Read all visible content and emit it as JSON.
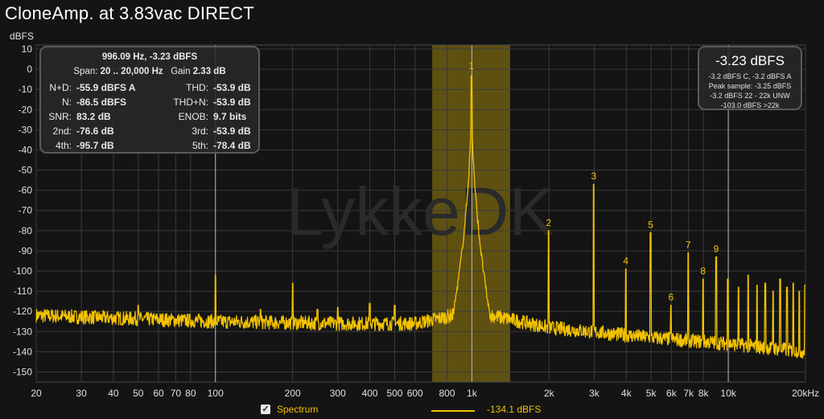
{
  "page": {
    "title": "CloneAmp. at 3.83vac DIRECT",
    "watermark": "LykkeDK",
    "colors": {
      "background": "#141414",
      "trace": "#f2c200",
      "band": "#6b5a10",
      "grid": "#3a3a3a"
    }
  },
  "measurements": {
    "header": "996.09 Hz, -3.23 dBFS",
    "span_label": "Span:",
    "span_value": "20 .. 20,000 Hz",
    "gain_label": "Gain",
    "gain_value": "2.33 dB",
    "rows": [
      {
        "l1": "N+D:",
        "v1": "-55.9 dBFS A",
        "l2": "THD:",
        "v2": "-53.9 dB"
      },
      {
        "l1": "N:",
        "v1": "-86.5 dBFS",
        "l2": "THD+N:",
        "v2": "-53.9 dB"
      },
      {
        "l1": "SNR:",
        "v1": "83.2 dB",
        "l2": "ENOB:",
        "v2": "9.7 bits"
      },
      {
        "l1": "2nd:",
        "v1": "-76.6 dB",
        "l2": "3rd:",
        "v2": "-53.9 dB"
      },
      {
        "l1": "4th:",
        "v1": "-95.7 dB",
        "l2": "5th:",
        "v2": "-78.4 dB"
      }
    ]
  },
  "level_panel": {
    "main": "-3.23 dBFS",
    "lines": [
      "-3.2 dBFS C, -3.2 dBFS A",
      "Peak sample: -3.25 dBFS",
      "-3.2 dBFS 22 - 22k UNW",
      "-103.0 dBFS >22k"
    ]
  },
  "legend": {
    "checkbox_checked": true,
    "checkbox_mark": "✓",
    "series_name": "Spectrum",
    "cursor_value": "-134.1 dBFS"
  },
  "chart_data": {
    "type": "line",
    "ylabel": "dBFS",
    "xscale": "log",
    "xlim": [
      20,
      20000
    ],
    "ylim": [
      -155,
      12
    ],
    "grid": true,
    "yticks": [
      10,
      0,
      -10,
      -20,
      -30,
      -40,
      -50,
      -60,
      -70,
      -80,
      -90,
      -100,
      -110,
      -120,
      -130,
      -140,
      -150
    ],
    "xticks": [
      {
        "v": 20,
        "label": "20"
      },
      {
        "v": 30,
        "label": "30"
      },
      {
        "v": 40,
        "label": "40"
      },
      {
        "v": 50,
        "label": "50"
      },
      {
        "v": 60,
        "label": "60"
      },
      {
        "v": 70,
        "label": "70"
      },
      {
        "v": 80,
        "label": "80"
      },
      {
        "v": 100,
        "label": "100"
      },
      {
        "v": 200,
        "label": "200"
      },
      {
        "v": 300,
        "label": "300"
      },
      {
        "v": 400,
        "label": "400"
      },
      {
        "v": 500,
        "label": "500"
      },
      {
        "v": 600,
        "label": "600"
      },
      {
        "v": 800,
        "label": "800"
      },
      {
        "v": 1000,
        "label": "1k"
      },
      {
        "v": 2000,
        "label": "2k"
      },
      {
        "v": 3000,
        "label": "3k"
      },
      {
        "v": 4000,
        "label": "4k"
      },
      {
        "v": 5000,
        "label": "5k"
      },
      {
        "v": 6000,
        "label": "6k"
      },
      {
        "v": 7000,
        "label": "7k"
      },
      {
        "v": 8000,
        "label": "8k"
      },
      {
        "v": 10000,
        "label": "10k"
      },
      {
        "v": 20000,
        "label": "20kHz"
      }
    ],
    "highlight_band": [
      700,
      1410
    ],
    "cursor_lines": [
      100,
      1000,
      10000
    ],
    "series": [
      {
        "color": "#f2c200",
        "floor": [
          {
            "x": 20,
            "y": -122
          },
          {
            "x": 100,
            "y": -125
          },
          {
            "x": 300,
            "y": -126
          },
          {
            "x": 600,
            "y": -126
          },
          {
            "x": 1000,
            "y": -120
          },
          {
            "x": 2000,
            "y": -128
          },
          {
            "x": 5000,
            "y": -133
          },
          {
            "x": 10000,
            "y": -136
          },
          {
            "x": 20000,
            "y": -140
          }
        ],
        "fundamental": {
          "x": 996.09,
          "y": -3.23
        },
        "spurs": [
          {
            "x": 50,
            "y": -117
          },
          {
            "x": 100,
            "y": -102
          },
          {
            "x": 150,
            "y": -119
          },
          {
            "x": 200,
            "y": -106
          },
          {
            "x": 250,
            "y": -119
          },
          {
            "x": 300,
            "y": -118
          },
          {
            "x": 400,
            "y": -116
          },
          {
            "x": 500,
            "y": -117
          }
        ],
        "harmonics": [
          {
            "label": "2",
            "x": 1992,
            "y": -80
          },
          {
            "label": "3",
            "x": 2988,
            "y": -57
          },
          {
            "label": "4",
            "x": 3984,
            "y": -99
          },
          {
            "label": "5",
            "x": 4980,
            "y": -81
          },
          {
            "label": "6",
            "x": 5977,
            "y": -117
          },
          {
            "label": "7",
            "x": 6973,
            "y": -91
          },
          {
            "label": "8",
            "x": 7969,
            "y": -104
          },
          {
            "label": "9",
            "x": 8965,
            "y": -93
          },
          {
            "label": "",
            "x": 9961,
            "y": -104
          },
          {
            "label": "",
            "x": 10957,
            "y": -108
          },
          {
            "label": "",
            "x": 11953,
            "y": -102
          },
          {
            "label": "",
            "x": 12949,
            "y": -107
          },
          {
            "label": "",
            "x": 13945,
            "y": -106
          },
          {
            "label": "",
            "x": 14941,
            "y": -110
          },
          {
            "label": "",
            "x": 15937,
            "y": -104
          },
          {
            "label": "",
            "x": 16934,
            "y": -108
          },
          {
            "label": "",
            "x": 17930,
            "y": -106
          },
          {
            "label": "",
            "x": 18926,
            "y": -110
          },
          {
            "label": "",
            "x": 19922,
            "y": -107
          }
        ]
      }
    ]
  }
}
